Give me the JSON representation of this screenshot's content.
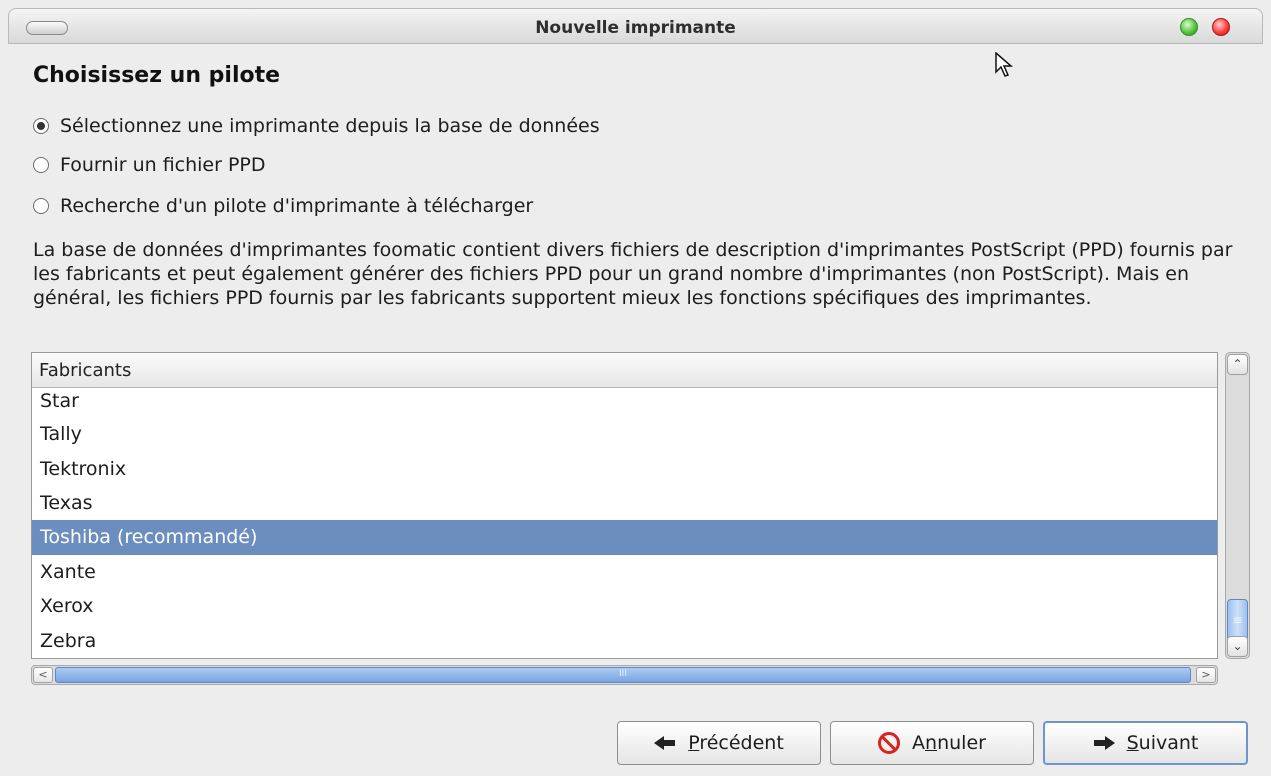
{
  "window": {
    "title": "Nouvelle imprimante"
  },
  "page": {
    "heading": "Choisissez un pilote",
    "radios": [
      {
        "label": "Sélectionnez une imprimante depuis la base de données",
        "checked": true
      },
      {
        "label": "Fournir un fichier PPD",
        "checked": false
      },
      {
        "label": "Recherche d'un pilote d'imprimante à télécharger",
        "checked": false
      }
    ],
    "description": "La base de données d'imprimantes foomatic contient divers fichiers de description d'imprimantes PostScript (PPD) fournis par les fabricants et peut également générer des fichiers PPD pour un grand nombre d'imprimantes (non PostScript). Mais en général, les fichiers PPD fournis par les fabricants supportent mieux les fonctions spécifiques des imprimantes."
  },
  "manufacturers": {
    "column_header": "Fabricants",
    "rows": [
      "Star",
      "Tally",
      "Tektronix",
      "Texas",
      "Toshiba (recommandé)",
      "Xante",
      "Xerox",
      "Zebra"
    ],
    "selected": "Toshiba (recommandé)"
  },
  "scrollbars": {
    "vertical_thumb_glyph": "≡",
    "horizontal_thumb_glyph": "III",
    "up_glyph": "⌃",
    "down_glyph": "⌄",
    "left_glyph": "<",
    "right_glyph": ">"
  },
  "buttons": {
    "previous": {
      "mnemonic": "P",
      "rest": "récédent",
      "icon": "arrow-left-icon"
    },
    "cancel": {
      "pre": "A",
      "mnemonic": "n",
      "rest": "nuler",
      "icon": "cancel-icon"
    },
    "next": {
      "mnemonic": "S",
      "rest": "uivant",
      "icon": "arrow-right-icon"
    }
  },
  "colors": {
    "selection": "#6c8ebf",
    "close_button": "#ff3f3a",
    "maximize_button": "#57c440",
    "scroll_thumb": "#9ec0ef"
  }
}
